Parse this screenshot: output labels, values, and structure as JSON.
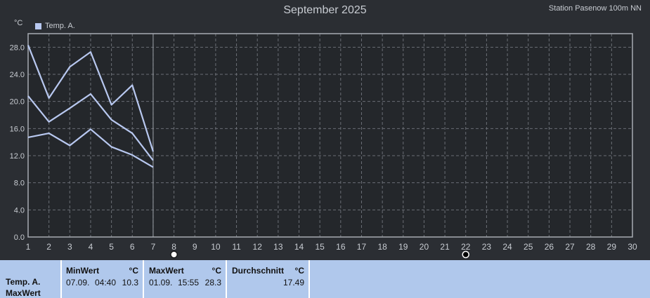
{
  "header": {
    "title": "September 2025",
    "station": "Station Pasenow 100m NN",
    "unit": "°C"
  },
  "legend": {
    "label": "Temp. A.",
    "color": "#b8c8f0"
  },
  "chart_data": {
    "type": "line",
    "title": "September 2025",
    "ylabel": "°C",
    "xlim": [
      1,
      30
    ],
    "ylim": [
      0,
      30
    ],
    "yticks": [
      "0.0",
      "4.0",
      "8.0",
      "12.0",
      "16.0",
      "20.0",
      "24.0",
      "28.0"
    ],
    "xticks": [
      "1",
      "2",
      "3",
      "4",
      "5",
      "6",
      "7",
      "8",
      "9",
      "10",
      "11",
      "12",
      "13",
      "14",
      "15",
      "16",
      "17",
      "18",
      "19",
      "20",
      "21",
      "22",
      "23",
      "24",
      "25",
      "26",
      "27",
      "28",
      "29",
      "30"
    ],
    "grid": true,
    "legend_position": "top-left",
    "current_day_marker": 7,
    "x": [
      1,
      2,
      3,
      4,
      5,
      6,
      7
    ],
    "series": [
      {
        "name": "Temp. A.",
        "values": [
          28.3,
          20.5,
          25.1,
          27.3,
          19.5,
          22.4,
          12.6
        ]
      },
      {
        "name": "Temp. A.",
        "values": [
          20.8,
          17.0,
          19.0,
          21.1,
          17.3,
          15.3,
          11.3
        ]
      },
      {
        "name": "Temp. A.",
        "values": [
          14.7,
          15.3,
          13.5,
          15.9,
          13.3,
          12.1,
          10.3
        ]
      }
    ],
    "moon_phases": [
      {
        "day": 8,
        "phase": "full"
      },
      {
        "day": 22,
        "phase": "new"
      }
    ]
  },
  "stats": {
    "row_label_1": "Temp. A.",
    "row_label_2": "MaxWert",
    "min": {
      "header": "MinWert",
      "unit": "°C",
      "date": "07.09.",
      "time": "04:40",
      "value": "10.3"
    },
    "max": {
      "header": "MaxWert",
      "unit": "°C",
      "date": "01.09.",
      "time": "15:55",
      "value": "28.3"
    },
    "avg": {
      "header": "Durchschnitt",
      "unit": "°C",
      "value": "17.49"
    }
  }
}
